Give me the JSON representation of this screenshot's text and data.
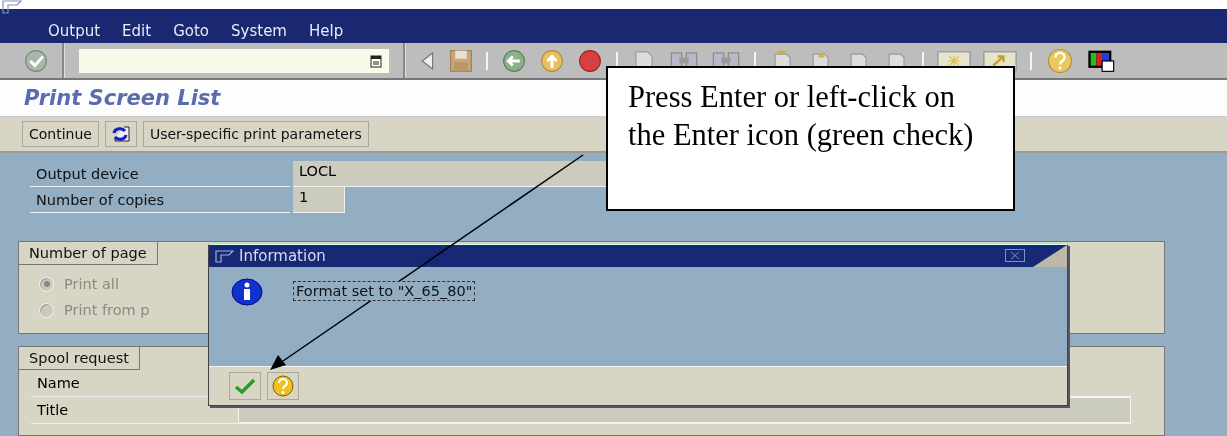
{
  "menu_bar": {
    "items": [
      "Output",
      "Edit",
      "Goto",
      "System",
      "Help"
    ]
  },
  "screen_title": "Print Screen List",
  "application_toolbar": [
    {
      "kind": "text",
      "label": "Continue"
    },
    {
      "kind": "icon"
    },
    {
      "kind": "text",
      "label": "User-specific print parameters"
    }
  ],
  "fields": [
    {
      "label": "Output device",
      "value": "LOCL",
      "kind": "wide"
    },
    {
      "label": "Number of copies",
      "value": "1",
      "kind": "short"
    }
  ],
  "pages_group": {
    "title": "Number of page",
    "disabled": true,
    "options": [
      {
        "label": "Print all",
        "selected": true
      },
      {
        "label": "Print from p",
        "selected": false
      }
    ]
  },
  "spool_group": {
    "title": "Spool request",
    "rows": [
      {
        "label": "Name",
        "kind": "hidden"
      },
      {
        "label": "Title",
        "kind": "field"
      }
    ]
  },
  "dialog": {
    "title": "Information",
    "message": "Format set to \"X_65_80\"",
    "buttons": [
      {
        "kind": "enter"
      },
      {
        "kind": "help"
      }
    ]
  },
  "callout": {
    "text": "Press Enter or left-click on the Enter icon (green check)"
  }
}
